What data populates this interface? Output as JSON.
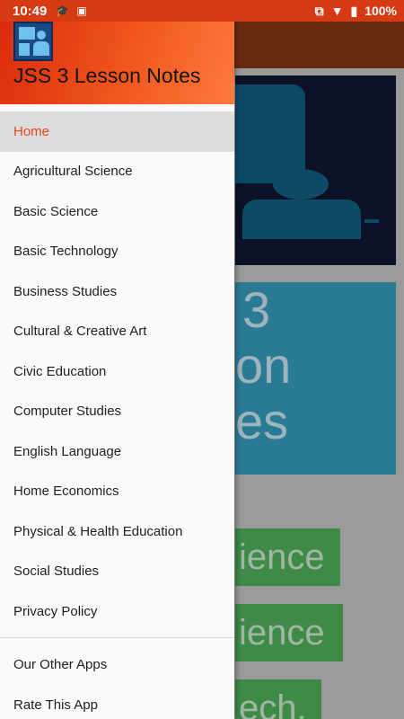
{
  "status_bar": {
    "time": "10:49",
    "battery": "100%"
  },
  "drawer": {
    "app_title": "JSS 3 Lesson Notes",
    "active_color": "#e8461a",
    "header_color": "#f0561d",
    "primary_items": [
      {
        "label": "Home",
        "active": true
      },
      {
        "label": "Agricultural Science"
      },
      {
        "label": "Basic Science"
      },
      {
        "label": "Basic Technology"
      },
      {
        "label": "Business Studies"
      },
      {
        "label": "Cultural & Creative Art"
      },
      {
        "label": "Civic Education"
      },
      {
        "label": "Computer Studies"
      },
      {
        "label": "English Language"
      },
      {
        "label": "Home Economics"
      },
      {
        "label": "Physical & Health Education"
      },
      {
        "label": "Social Studies"
      },
      {
        "label": "Privacy Policy"
      }
    ],
    "secondary_items": [
      {
        "label": "Our Other Apps"
      },
      {
        "label": "Rate This App"
      }
    ]
  },
  "background": {
    "title_card_lines": [
      "3",
      "on",
      "es"
    ],
    "subject_buttons": [
      "ience",
      "ience",
      "ech."
    ]
  }
}
